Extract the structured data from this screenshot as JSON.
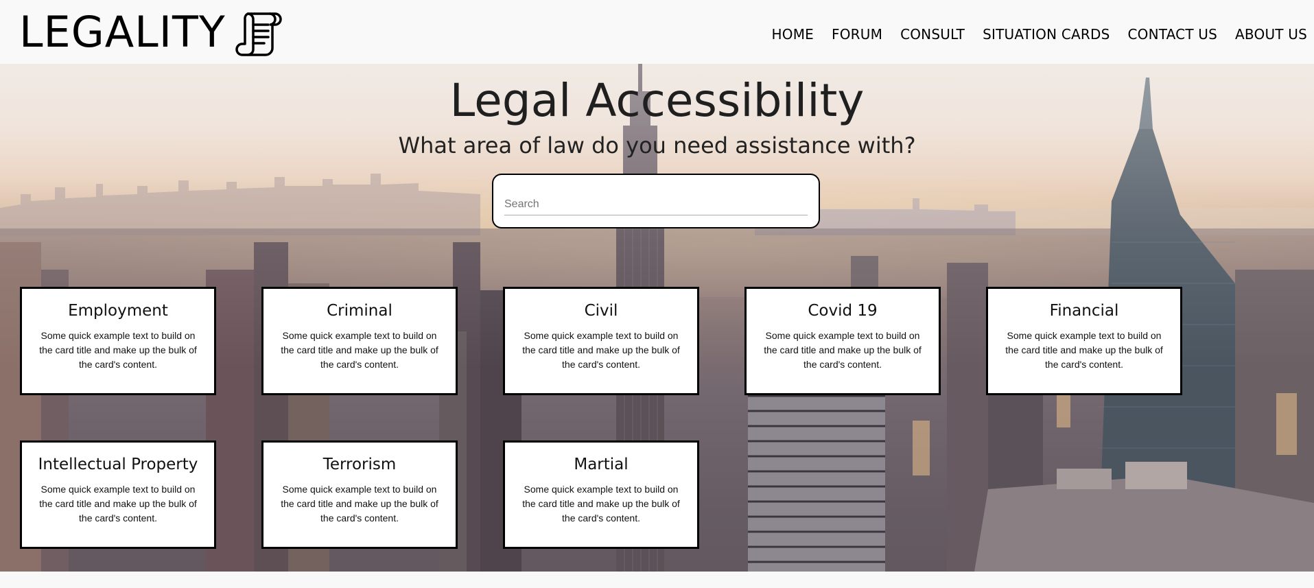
{
  "brand": {
    "name": "LEGALITY",
    "logo_icon": "scroll-icon"
  },
  "nav": [
    "HOME",
    "FORUM",
    "CONSULT",
    "SITUATION CARDS",
    "CONTACT US",
    "ABOUT US"
  ],
  "hero": {
    "title": "Legal Accessibility",
    "subtitle": "What area of law do you need assistance with?"
  },
  "search": {
    "placeholder": "Search",
    "value": ""
  },
  "cards": [
    {
      "title": "Employment",
      "text": "Some quick example text to build on the card title and make up the bulk of the card's content."
    },
    {
      "title": "Criminal",
      "text": "Some quick example text to build on the card title and make up the bulk of the card's content."
    },
    {
      "title": "Civil",
      "text": "Some quick example text to build on the card title and make up the bulk of the card's content."
    },
    {
      "title": "Covid 19",
      "text": "Some quick example text to build on the card title and make up the bulk of the card's content."
    },
    {
      "title": "Financial",
      "text": "Some quick example text to build on the card title and make up the bulk of the card's content."
    },
    {
      "title": "Intellectual Property",
      "text": "Some quick example text to build on the card title and make up the bulk of the card's content."
    },
    {
      "title": "Terrorism",
      "text": "Some quick example text to build on the card title and make up the bulk of the card's content."
    },
    {
      "title": "Martial",
      "text": "Some quick example text to build on the card title and make up the bulk of the card's content."
    }
  ],
  "colors": {
    "card_border": "#000000",
    "card_bg": "#ffffff",
    "header_bg": "#f9f9f9"
  }
}
